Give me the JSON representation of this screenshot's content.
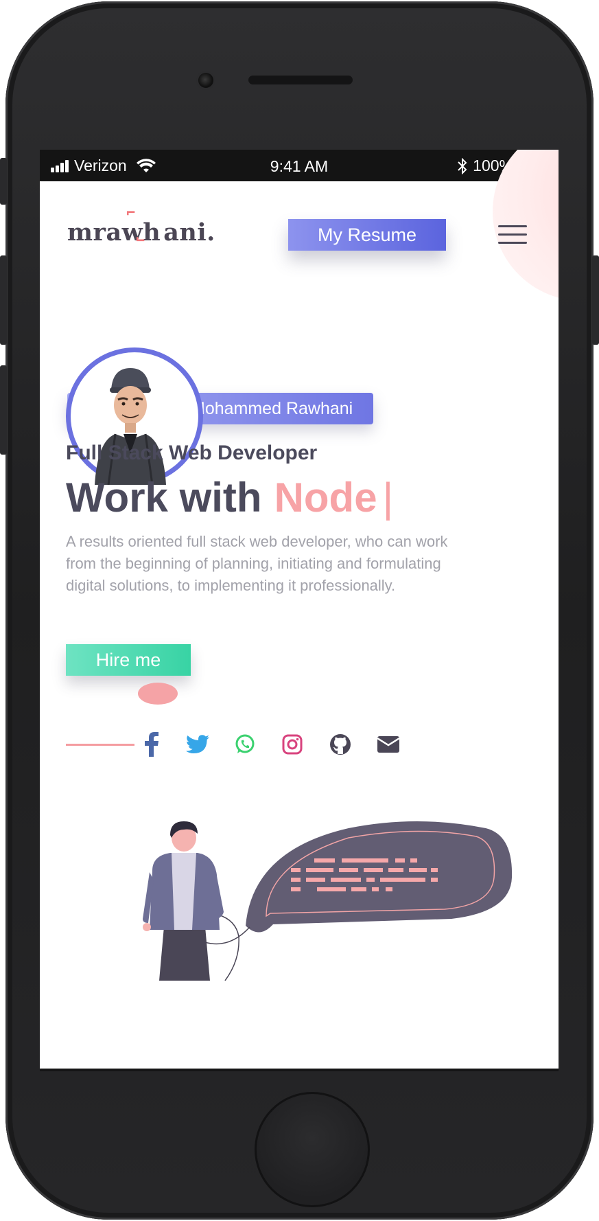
{
  "status_bar": {
    "carrier": "Verizon",
    "time": "9:41 AM",
    "battery": "100%"
  },
  "header": {
    "logo_left": "mrawh",
    "logo_right": "ani.",
    "resume_button": "My Resume"
  },
  "profile": {
    "name": "Mohammed Rawhani",
    "role": "Full Stack Web Developer",
    "headline_prefix": "Work with",
    "headline_accent": "Node",
    "headline_caret": "|",
    "description": "A results oriented full stack web developer, who can work from the beginning of planning, initiating and formulating digital solutions, to implementing it professionally.",
    "hire_button": "Hire me"
  },
  "social_links": [
    {
      "icon": "facebook-icon",
      "color": "#4b68a8"
    },
    {
      "icon": "twitter-icon",
      "color": "#36a6e8"
    },
    {
      "icon": "whatsapp-icon",
      "color": "#3bd16f"
    },
    {
      "icon": "instagram-icon",
      "color": "#d8437e"
    },
    {
      "icon": "github-icon",
      "color": "#4a4656"
    },
    {
      "icon": "email-icon",
      "color": "#4a4656"
    }
  ],
  "colors": {
    "accent_blue": "#6b71e0",
    "accent_pink": "#f7a3a6",
    "accent_green": "#38d3a4",
    "text_dark": "#4b4a5c",
    "text_muted": "#a2a2aa"
  }
}
